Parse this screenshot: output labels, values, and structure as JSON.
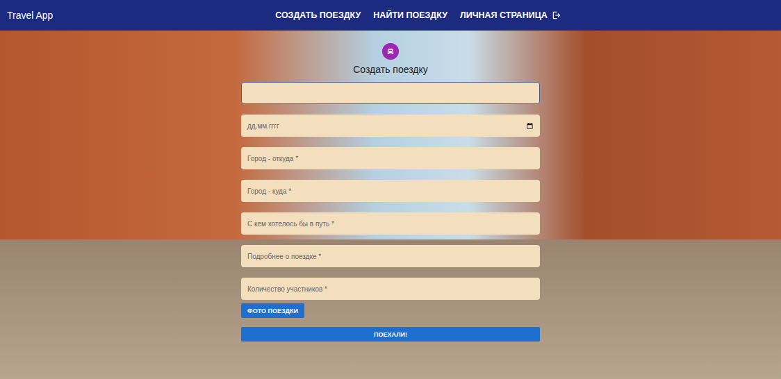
{
  "app_bar": {
    "title": "Travel App",
    "links": [
      {
        "label": "СОЗДАТЬ ПОЕЗДКУ",
        "icon": false
      },
      {
        "label": "НАЙТИ ПОЕЗДКУ",
        "icon": false
      },
      {
        "label": "ЛИЧНАЯ СТРАНИЦА",
        "icon": true
      }
    ]
  },
  "form": {
    "title": "Создать поездку",
    "fields": [
      {
        "kind": "text",
        "placeholder": "",
        "focused": true
      },
      {
        "kind": "date",
        "placeholder": "дд.мм.гггг",
        "focused": false
      },
      {
        "kind": "text",
        "placeholder": "Город - откуда *",
        "focused": false
      },
      {
        "kind": "text",
        "placeholder": "Город - куда *",
        "focused": false
      },
      {
        "kind": "text",
        "placeholder": "С кем хотелось бы в путь *",
        "focused": false
      },
      {
        "kind": "text",
        "placeholder": "Подробнее о поездке *",
        "focused": false
      },
      {
        "kind": "text",
        "placeholder": "Количество участников *",
        "focused": false
      }
    ],
    "photo_button": "ФОТО ПОЕЗДКИ",
    "submit_button": "ПОЕХАЛИ!"
  }
}
